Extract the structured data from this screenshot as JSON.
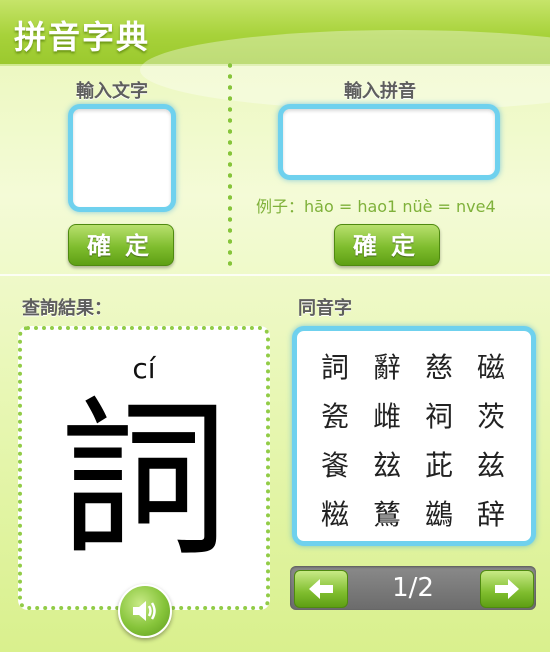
{
  "app": {
    "title": "拼音字典"
  },
  "left_input": {
    "label": "輸入文字",
    "value": "",
    "button": "確定"
  },
  "right_input": {
    "label": "輸入拼音",
    "value": "",
    "button": "確定",
    "example": "例子：hāo = hao1   nüè = nve4"
  },
  "result": {
    "label": "查詢結果：",
    "pinyin": "cí",
    "character": "詞",
    "speaker_icon": "speaker-icon"
  },
  "homophones": {
    "label": "同音字",
    "chars": [
      "詞",
      "辭",
      "慈",
      "磁",
      "瓷",
      "雌",
      "祠",
      "茨",
      "餈",
      "玆",
      "茈",
      "兹",
      "糍",
      "鶿",
      "鷀",
      "辞"
    ]
  },
  "pager": {
    "page": "1/2",
    "prev_icon": "arrow-left-icon",
    "next_icon": "arrow-right-icon"
  },
  "colors": {
    "accent_green": "#86c43a",
    "input_border": "#6fd1ee",
    "pager_bg": "#777777"
  }
}
